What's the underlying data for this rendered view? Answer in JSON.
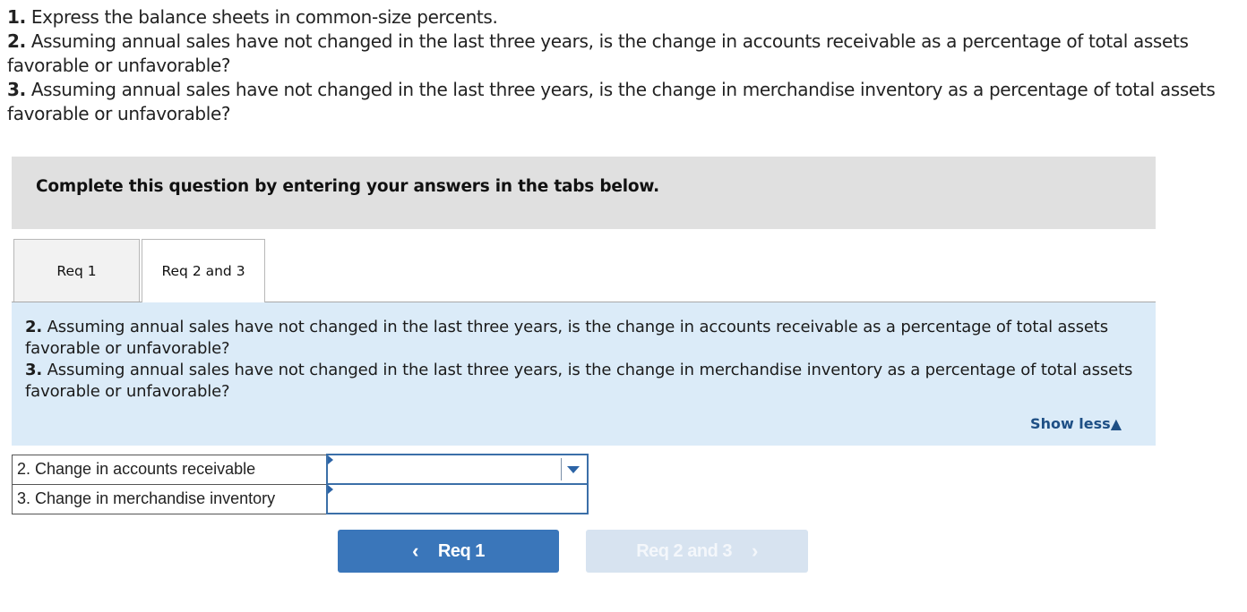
{
  "instructions": [
    {
      "num": "1.",
      "text": " Express the balance sheets in common-size percents."
    },
    {
      "num": "2.",
      "text": " Assuming annual sales have not changed in the last three years, is the change in accounts receivable as a percentage of total assets favorable or unfavorable?"
    },
    {
      "num": "3.",
      "text": " Assuming annual sales have not changed in the last three years, is the change in merchandise inventory as a percentage of total assets favorable or unfavorable?"
    }
  ],
  "banner": {
    "text": "Complete this question by entering your answers in the tabs below."
  },
  "tabs": [
    {
      "label": "Req 1",
      "active": false
    },
    {
      "label": "Req 2 and 3",
      "active": true
    }
  ],
  "panel": {
    "questions": [
      {
        "num": "2.",
        "text": " Assuming annual sales have not changed in the last three years, is the change in accounts receivable as a percentage of total assets favorable or unfavorable?"
      },
      {
        "num": "3.",
        "text": " Assuming annual sales have not changed in the last three years, is the change in merchandise inventory as a percentage of total assets favorable or unfavorable?"
      }
    ],
    "show_less": "Show less",
    "show_less_icon": "▲"
  },
  "answers": [
    {
      "label": "2. Change in accounts receivable",
      "type": "dropdown",
      "value": ""
    },
    {
      "label": "3. Change in merchandise inventory",
      "type": "text",
      "value": ""
    }
  ],
  "nav": {
    "prev": {
      "label": "Req 1",
      "icon": "‹",
      "enabled": true
    },
    "next": {
      "label": "Req 2 and 3",
      "icon": "›",
      "enabled": false
    }
  },
  "colors": {
    "primary_button": "#3a76ba",
    "disabled_button": "#d7e3f0",
    "panel_bg": "#dbebf8",
    "banner_bg": "#e0e0e0",
    "link": "#1e4f85"
  }
}
